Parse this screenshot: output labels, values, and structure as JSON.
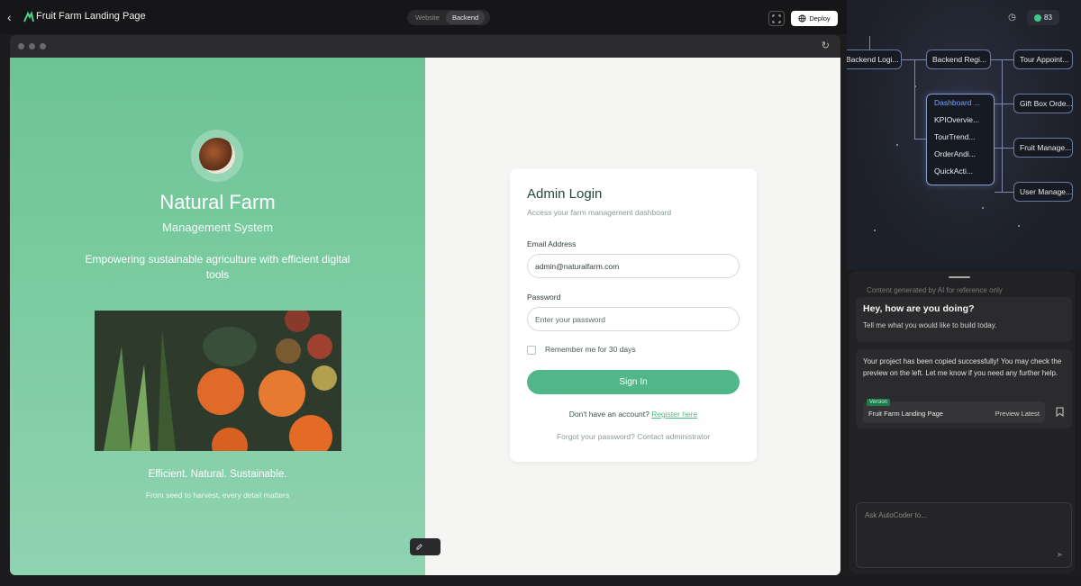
{
  "topbar": {
    "title": "Fruit Farm Landing Page",
    "tabs": [
      {
        "label": "Website",
        "active": false
      },
      {
        "label": "Backend",
        "active": true
      }
    ],
    "deploy_label": "Deploy"
  },
  "credits": {
    "count": "83"
  },
  "graph": {
    "nodes": [
      "Backend Logi...",
      "Backend Regi...",
      "Tour Appoint...",
      "Gift Box Orde...",
      "Fruit Manage...",
      "User Manage..."
    ],
    "group_items": [
      "Dashboard ...",
      "KPIOvervie...",
      "TourTrend...",
      "OrderAndi...",
      "QuickActi..."
    ]
  },
  "preview": {
    "left": {
      "title": "Natural Farm",
      "subtitle": "Management System",
      "description": "Empowering sustainable agriculture with efficient digital tools",
      "tagline": "Efficient. Natural. Sustainable.",
      "tag_sub": "From seed to harvest, every detail matters"
    },
    "login": {
      "title": "Admin Login",
      "subtitle": "Access your farm management dashboard",
      "email_label": "Email Address",
      "email_value": "admin@naturalfarm.com",
      "password_label": "Password",
      "password_placeholder": "Enter your password",
      "remember_label": "Remember me for 30 days",
      "signin_label": "Sign In",
      "register_prefix": "Don't have an account?",
      "register_link": "Register here",
      "forgot_text": "Forgot your password? Contact administrator"
    }
  },
  "chat": {
    "disclaimer": "Content generated by AI for reference only",
    "greeting_title": "Hey, how are you doing?",
    "greeting_text": "Tell me what you would like to build today.",
    "reply_text": "Your project has been copied successfully! You may check the preview on the left. Let me know if you need any further help.",
    "version_badge": "Version",
    "version_name": "Fruit Farm Landing Page",
    "version_action": "Preview Latest",
    "input_placeholder": "Ask AutoCoder to..."
  },
  "colors": {
    "accent": "#52b788",
    "left_panel": "#6cc495"
  }
}
